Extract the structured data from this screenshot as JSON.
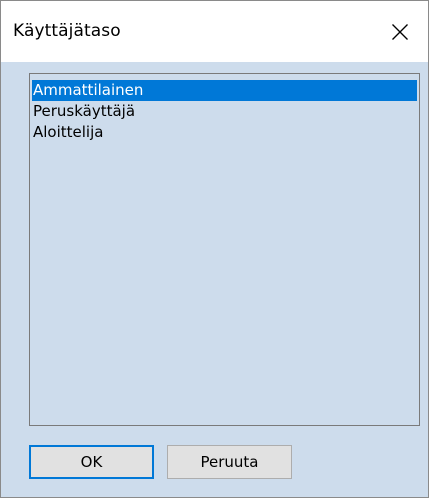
{
  "window": {
    "title": "Käyttäjätaso",
    "close_icon": "close-icon"
  },
  "list": {
    "items": [
      {
        "label": "Ammattilainen",
        "selected": true
      },
      {
        "label": "Peruskäyttäjä",
        "selected": false
      },
      {
        "label": "Aloittelija",
        "selected": false
      }
    ]
  },
  "buttons": {
    "ok_label": "OK",
    "cancel_label": "Peruuta"
  },
  "colors": {
    "selection": "#0078d7",
    "dialog_background": "#cddcec",
    "titlebar": "#ffffff"
  }
}
